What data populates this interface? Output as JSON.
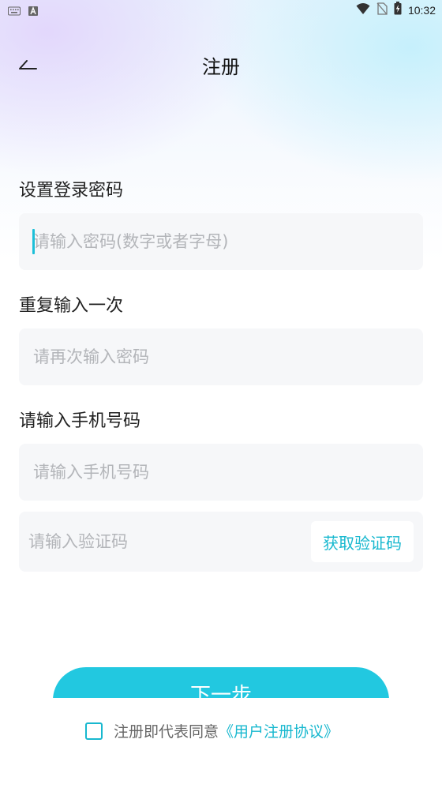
{
  "status_bar": {
    "time": "10:32",
    "icons": [
      "keyboard-icon",
      "a-notification-icon",
      "wifi-icon",
      "no-sim-icon",
      "battery-charging-icon"
    ]
  },
  "header": {
    "title": "注册",
    "back_icon": "back-arrow-icon"
  },
  "form": {
    "password": {
      "label": "设置登录密码",
      "placeholder": "请输入密码(数字或者字母)",
      "value": ""
    },
    "repeat": {
      "label": "重复输入一次",
      "placeholder": "请再次输入密码",
      "value": ""
    },
    "phone": {
      "label": "请输入手机号码",
      "placeholder": "请输入手机号码",
      "value": ""
    },
    "code": {
      "placeholder": "请输入验证码",
      "value": "",
      "button_label": "获取验证码"
    }
  },
  "next_button": {
    "label": "下一步"
  },
  "agreement": {
    "text": "注册即代表同意",
    "link": "《用户注册协议》",
    "checked": false
  },
  "colors": {
    "accent": "#22c8e0",
    "link": "#18b8cf",
    "input_bg": "#f6f7f9",
    "placeholder": "#b3b5b9"
  }
}
